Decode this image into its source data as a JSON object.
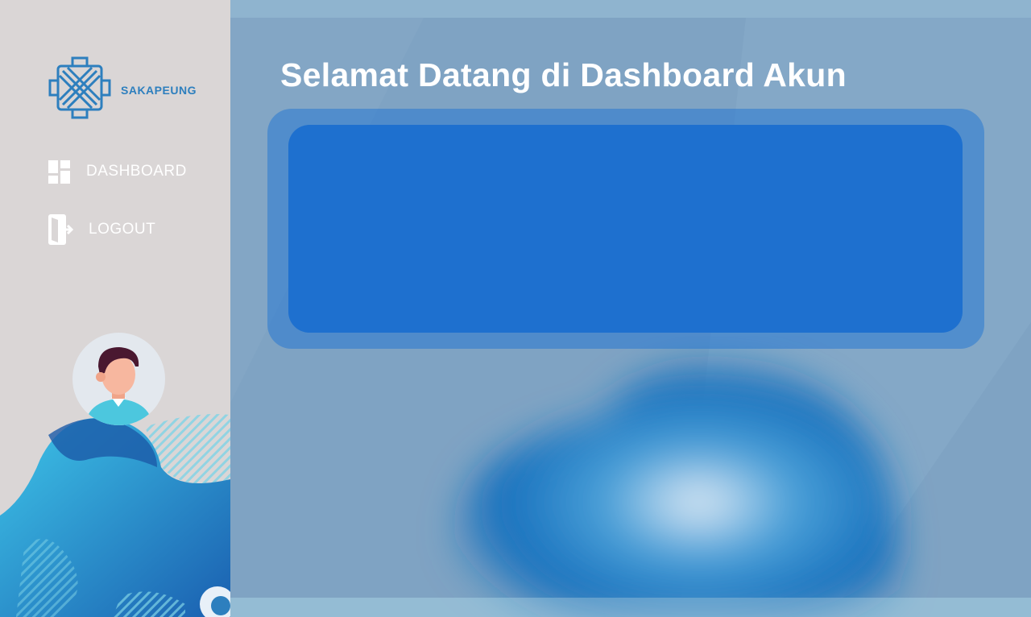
{
  "brand": {
    "name": "SAKAPEUNG",
    "logo_icon": "sakapeung-logo-icon"
  },
  "sidebar": {
    "items": [
      {
        "label": "DASHBOARD",
        "icon": "dashboard-grid-icon"
      },
      {
        "label": "LOGOUT",
        "icon": "logout-door-icon"
      }
    ],
    "avatar_icon": "user-avatar-icon"
  },
  "main": {
    "title": "Selamat Datang di Dashboard Akun"
  },
  "colors": {
    "sidebar_bg": "#dad6d6",
    "main_bg": "#7fa3c3",
    "card_bg": "#1e70cf",
    "brand": "#2d7fbe"
  }
}
